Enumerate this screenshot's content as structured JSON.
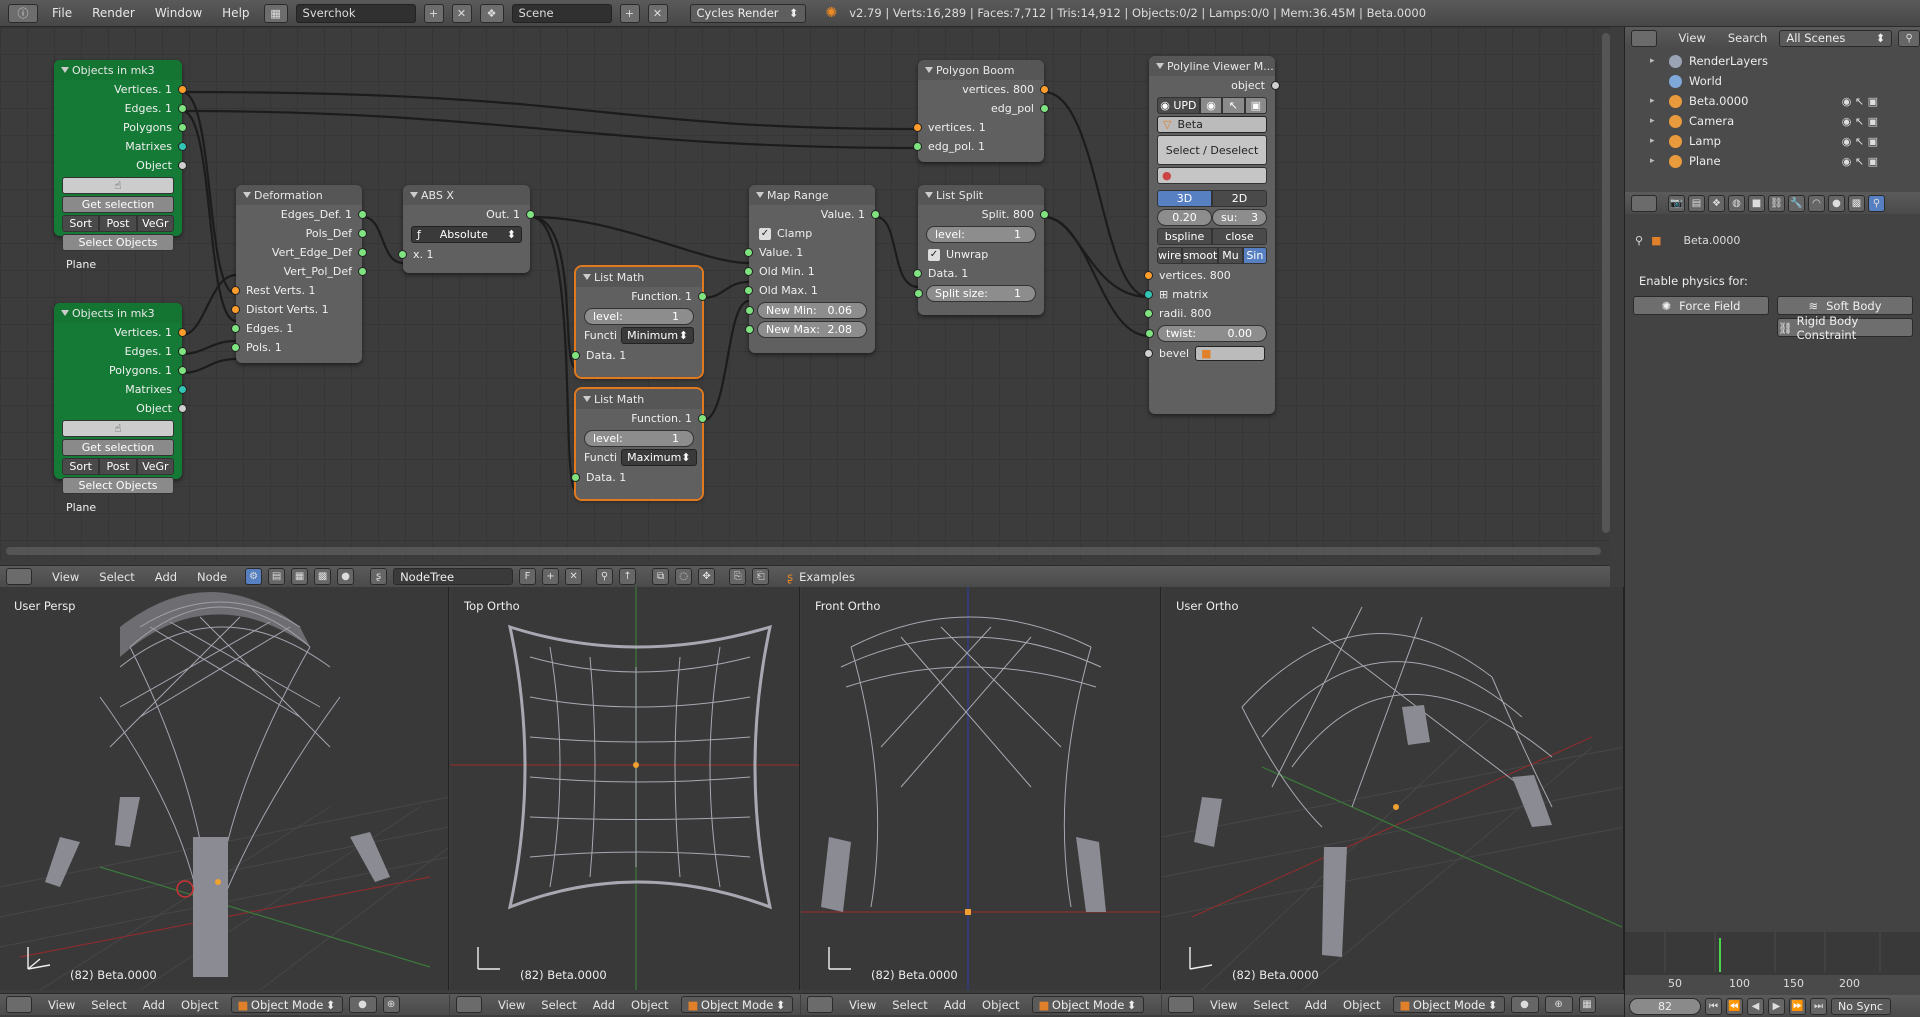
{
  "topbar": {
    "menus": [
      "File",
      "Render",
      "Window",
      "Help"
    ],
    "screen_layout": "Sverchok",
    "scene": "Scene",
    "render_engine": "Cycles Render",
    "stats": "v2.79 | Verts:16,289 | Faces:7,712 | Tris:14,912 | Objects:0/2 | Lamps:0/0 | Mem:36.45M | Beta.0000"
  },
  "nodes": {
    "obj1": {
      "title": "Objects in mk3",
      "outputs": [
        "Vertices. 1",
        "Edges. 1",
        "Polygons",
        "Matrixes",
        "Object"
      ],
      "get_selection": "Get selection",
      "sort": "Sort",
      "post": "Post",
      "vegr": "VeGr",
      "select_objects": "Select Objects",
      "item": "Plane"
    },
    "obj2": {
      "title": "Objects in mk3",
      "outputs": [
        "Vertices. 1",
        "Edges. 1",
        "Polygons. 1",
        "Matrixes",
        "Object"
      ],
      "get_selection": "Get selection",
      "sort": "Sort",
      "post": "Post",
      "vegr": "VeGr",
      "select_objects": "Select Objects",
      "item": "Plane"
    },
    "deform": {
      "title": "Deformation",
      "outputs": [
        "Edges_Def. 1",
        "Pols_Def",
        "Vert_Edge_Def",
        "Vert_Pol_Def"
      ],
      "inputs": [
        "Rest Verts. 1",
        "Distort Verts. 1",
        "Edges. 1",
        "Pols. 1"
      ]
    },
    "absx": {
      "title": "ABS X",
      "out": "Out. 1",
      "mode": "Absolute",
      "input": "x. 1"
    },
    "lm1": {
      "title": "List Math",
      "out": "Function. 1",
      "level_label": "level:",
      "level": "1",
      "func_label": "Functi",
      "func": "Minimum",
      "input": "Data. 1"
    },
    "lm2": {
      "title": "List Math",
      "out": "Function. 1",
      "level_label": "level:",
      "level": "1",
      "func_label": "Functi",
      "func": "Maximum",
      "input": "Data. 1"
    },
    "maprange": {
      "title": "Map Range",
      "out": "Value. 1",
      "clamp": "Clamp",
      "inputs": [
        "Value. 1",
        "Old Min. 1",
        "Old Max. 1"
      ],
      "new_min_label": "New Min:",
      "new_min": "0.06",
      "new_max_label": "New Max:",
      "new_max": "2.08"
    },
    "listsplit": {
      "title": "List Split",
      "out": "Split. 800",
      "level_label": "level:",
      "level": "1",
      "unwrap": "Unwrap",
      "input": "Data. 1",
      "split_label": "Split size:",
      "split": "1"
    },
    "polyboom": {
      "title": "Polygon Boom",
      "outputs": [
        "vertices. 800",
        "edg_pol"
      ],
      "inputs": [
        "vertices. 1",
        "edg_pol. 1"
      ]
    },
    "polyviewer": {
      "title": "Polyline Viewer M...",
      "object_label": "object",
      "upd": "UPD",
      "name": "Beta",
      "select_deselect": "Select / Deselect",
      "mode3d": "3D",
      "mode2d": "2D",
      "val1": "0.20",
      "su_label": "su:",
      "su": "3",
      "bspline": "bspline",
      "close": "close",
      "wire": "wire",
      "smooth": "smoot",
      "mu": "Mu",
      "sin": "Sin",
      "inputs": [
        "vertices. 800",
        "matrix",
        "radii. 800",
        "bevel"
      ],
      "twist_label": "twist:",
      "twist": "0.00"
    }
  },
  "node_header": {
    "menus": [
      "View",
      "Select",
      "Add",
      "Node"
    ],
    "tree": "NodeTree",
    "fake": "F",
    "examples": "Examples"
  },
  "viewports": [
    {
      "label": "User Persp",
      "footer": "(82) Beta.0000"
    },
    {
      "label": "Top Ortho",
      "footer": "(82) Beta.0000"
    },
    {
      "label": "Front Ortho",
      "footer": "(82) Beta.0000"
    },
    {
      "label": "User Ortho",
      "footer": "(82) Beta.0000"
    }
  ],
  "vp_header": {
    "menus": [
      "View",
      "Select",
      "Add",
      "Object"
    ],
    "mode": "Object Mode"
  },
  "outliner": {
    "menus": [
      "View",
      "Search"
    ],
    "filter": "All Scenes",
    "items": [
      {
        "name": "RenderLayers",
        "color": "#9aa4b5"
      },
      {
        "name": "World",
        "color": "#7fa8d8"
      },
      {
        "name": "Beta.0000",
        "color": "#e89a3c"
      },
      {
        "name": "Camera",
        "color": "#e89a3c"
      },
      {
        "name": "Lamp",
        "color": "#e89a3c"
      },
      {
        "name": "Plane",
        "color": "#e89a3c"
      }
    ]
  },
  "props": {
    "object_name": "Beta.0000",
    "enable_label": "Enable physics for:",
    "force_field": "Force Field",
    "soft_body": "Soft Body",
    "rigid_body": "Rigid Body Constraint"
  },
  "timeline": {
    "ticks": [
      "50",
      "100",
      "150",
      "200"
    ],
    "frame": "82",
    "sync": "No Sync"
  }
}
